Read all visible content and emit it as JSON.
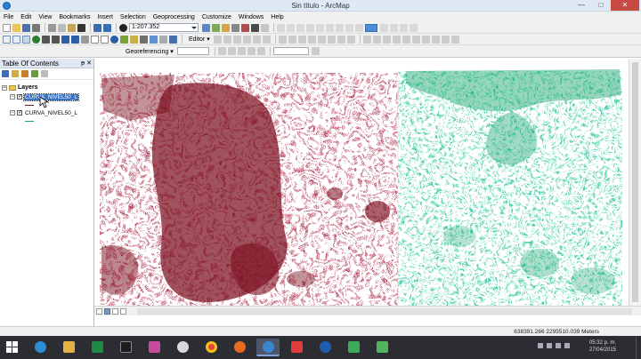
{
  "window": {
    "title": "Sin título - ArcMap",
    "minimize": "—",
    "maximize": "□",
    "close": "✕"
  },
  "menu": [
    "File",
    "Edit",
    "View",
    "Bookmarks",
    "Insert",
    "Selection",
    "Geoprocessing",
    "Customize",
    "Windows",
    "Help"
  ],
  "toolbar": {
    "scale": "1:207.352",
    "editor_label": "Editor ▾",
    "georeferencing_label": "Georeferencing ▾"
  },
  "toc": {
    "title": "Table Of Contents",
    "pin": "ᵽ",
    "close": "✕",
    "group_label": "Layers",
    "layers": [
      {
        "name": "CURVA_NIVEL50_L",
        "selected": true,
        "color": "#7b0f1f"
      },
      {
        "name": "CURVA_NIVEL50_L",
        "selected": false,
        "color": "#14a36b"
      }
    ]
  },
  "map": {
    "west_color": "#7b0f1f",
    "east_color": "#14a36b"
  },
  "status": {
    "coordinates": "638391.266  2295510.039 Meters"
  },
  "taskbar": {
    "time": "05:32 p. m.",
    "date": "27/04/2015",
    "icons": [
      "ie-icon",
      "explorer-icon",
      "excel-icon",
      "media-player-icon",
      "color-app-icon",
      "hp-icon",
      "chrome-icon",
      "firefox-icon",
      "arcmap-icon",
      "popcorn-icon",
      "globe-icon",
      "catalog-icon",
      "green-app-icon"
    ]
  },
  "colors": {
    "accent": "#3b73c4",
    "close": "#c74b42",
    "taskbar": "#2b2d33"
  }
}
